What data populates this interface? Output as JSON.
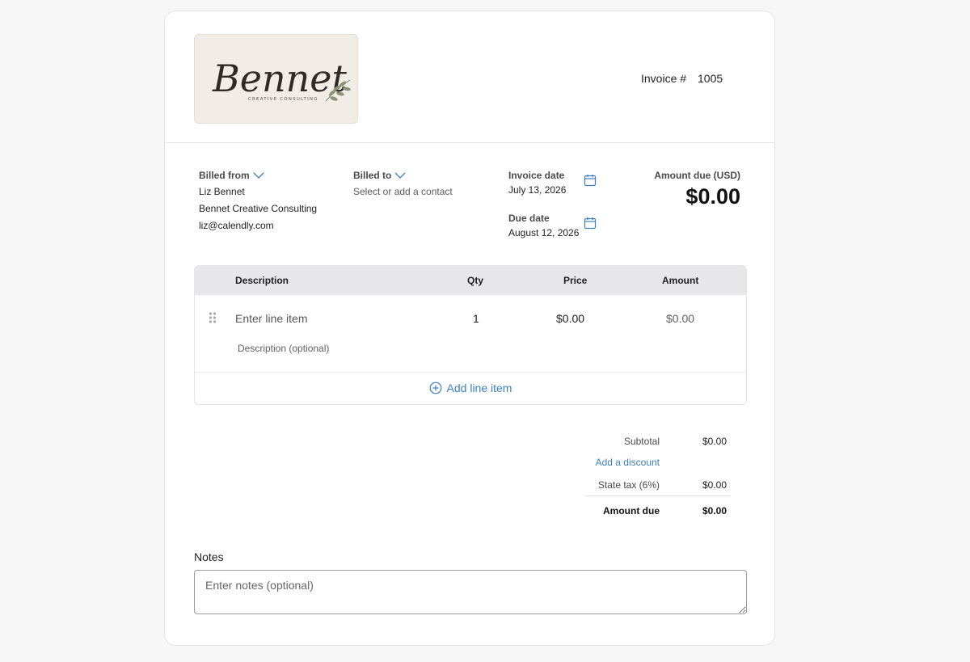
{
  "invoice": {
    "number_label": "Invoice #",
    "number_value": "1005"
  },
  "logo": {
    "name": "Bennet",
    "tagline": "CREATIVE CONSULTING"
  },
  "billed_from": {
    "label": "Billed from",
    "name": "Liz Bennet",
    "company": "Bennet Creative Consulting",
    "email": "liz@calendly.com"
  },
  "billed_to": {
    "label": "Billed to",
    "placeholder": "Select or add a contact"
  },
  "invoice_date": {
    "label": "Invoice date",
    "value": "July 13, 2026"
  },
  "due_date": {
    "label": "Due date",
    "value": "August 12, 2026"
  },
  "amount_due_header": {
    "label": "Amount due (USD)",
    "value": "$0.00"
  },
  "items": {
    "headers": {
      "description": "Description",
      "qty": "Qty",
      "price": "Price",
      "amount": "Amount"
    },
    "rows": [
      {
        "description_placeholder": "Enter line item",
        "description_optional": "Description (optional)",
        "qty": "1",
        "price": "$0.00",
        "amount": "$0.00"
      }
    ],
    "add_label": "Add line item"
  },
  "totals": {
    "subtotal_label": "Subtotal",
    "subtotal_value": "$0.00",
    "discount_label": "Add a discount",
    "tax_label": "State tax (6%)",
    "tax_value": "$0.00",
    "due_label": "Amount due",
    "due_value": "$0.00"
  },
  "notes": {
    "label": "Notes",
    "placeholder": "Enter notes (optional)"
  },
  "colors": {
    "accent": "#3b7fc4",
    "header_bg": "#e7e7ea",
    "logo_bg": "#f1ece5"
  }
}
